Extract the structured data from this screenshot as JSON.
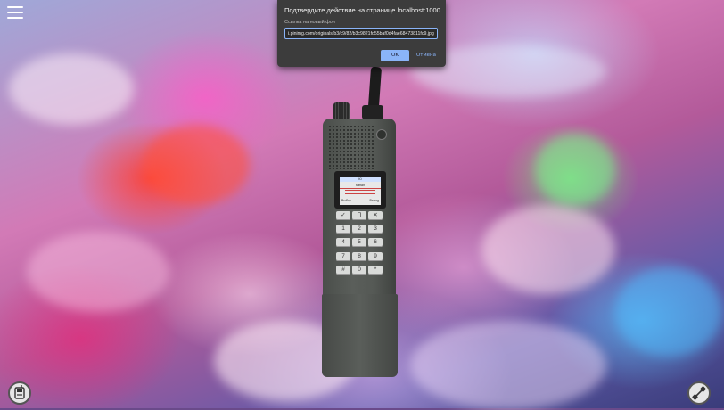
{
  "dialog": {
    "title": "Подтвердите действие на странице localhost:1000",
    "message": "Ссылка на новый фон",
    "input_value": "i.pinimg.com/originals/b3/c9/82/b3c9821fd55baf0d4fae68473811fc9.jpg",
    "ok_label": "OK",
    "cancel_label": "Отмена"
  },
  "radio": {
    "screen_header": "Ю",
    "screen_menu": "Канал",
    "screen_footer_left": "Выбор",
    "screen_footer_right": "Выход",
    "keys": [
      "✓",
      "П",
      "✕",
      "1",
      "2",
      "3",
      "4",
      "5",
      "6",
      "7",
      "8",
      "9",
      "#",
      "0",
      "*"
    ]
  },
  "icons": {
    "menu": "hamburger-icon",
    "bottom_left": "radio-settings-icon",
    "bottom_right": "connection-icon"
  }
}
